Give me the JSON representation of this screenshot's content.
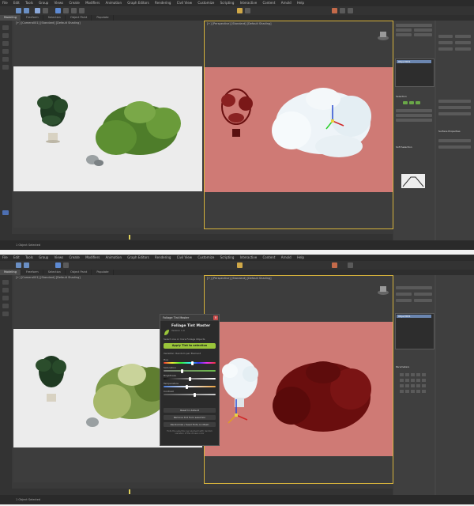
{
  "top": {
    "menu": [
      "File",
      "Edit",
      "Tools",
      "Group",
      "Views",
      "Create",
      "Modifiers",
      "Animation",
      "Graph Editors",
      "Rendering",
      "Civil View",
      "Customize",
      "Scripting",
      "Interactive",
      "Content",
      "Arnold",
      "Help"
    ],
    "tabs": [
      "Modeling",
      "Freeform",
      "Selection",
      "Object Paint",
      "Populate"
    ],
    "vp_left_label": "[+] [Camera001] [Standard] [Default Shading]",
    "vp_right_label": "[+] [Perspective] [Standard] [Default Shading]",
    "status_text": "1 Object Selected",
    "panel_list_item": "Object001",
    "panel_sections": [
      "Selection",
      "Soft Selection",
      "Surface Properties"
    ]
  },
  "bottom": {
    "menu": [
      "File",
      "Edit",
      "Tools",
      "Group",
      "Views",
      "Create",
      "Modifiers",
      "Animation",
      "Graph Editors",
      "Rendering",
      "Civil View",
      "Customize",
      "Scripting",
      "Interactive",
      "Content",
      "Arnold",
      "Help"
    ],
    "tabs": [
      "Modeling",
      "Freeform",
      "Selection",
      "Object Paint",
      "Populate"
    ],
    "vp_left_label": "[+] [Camera001] [Standard] [Default Shading]",
    "vp_right_label": "[+] [Perspective] [Standard] [Default Shading]",
    "status_text": "1 Object Selected",
    "panel_list_item": "Object001",
    "panel_sections": [
      "Parameters"
    ]
  },
  "dialog": {
    "title": "Foliage Tint Master",
    "heading": "Foliage Tint Master",
    "subheading": "Version 1.0",
    "intro": "Select one or more Foliage Objects",
    "apply_label": "Apply Tint to selection",
    "mode_label": "Variation:  Random per Element",
    "sliders": [
      {
        "label": "Hue",
        "value": 0.55
      },
      {
        "label": "Saturation",
        "value": 0.35
      },
      {
        "label": "Brightness",
        "value": 0.5
      },
      {
        "label": "Temperature",
        "value": 0.45
      },
      {
        "label": "Contrast",
        "value": 0.6
      }
    ],
    "buttons": [
      "Reset to default",
      "Remove tint from selection",
      "Randomize / Seed Tints on Mesh"
    ],
    "note": "Tints the selection per element with random variation of the chosen color"
  },
  "colors": {
    "apply": "#9ac53a",
    "viewport_red": "#cf7a75",
    "viewport_white": "#ececec"
  }
}
